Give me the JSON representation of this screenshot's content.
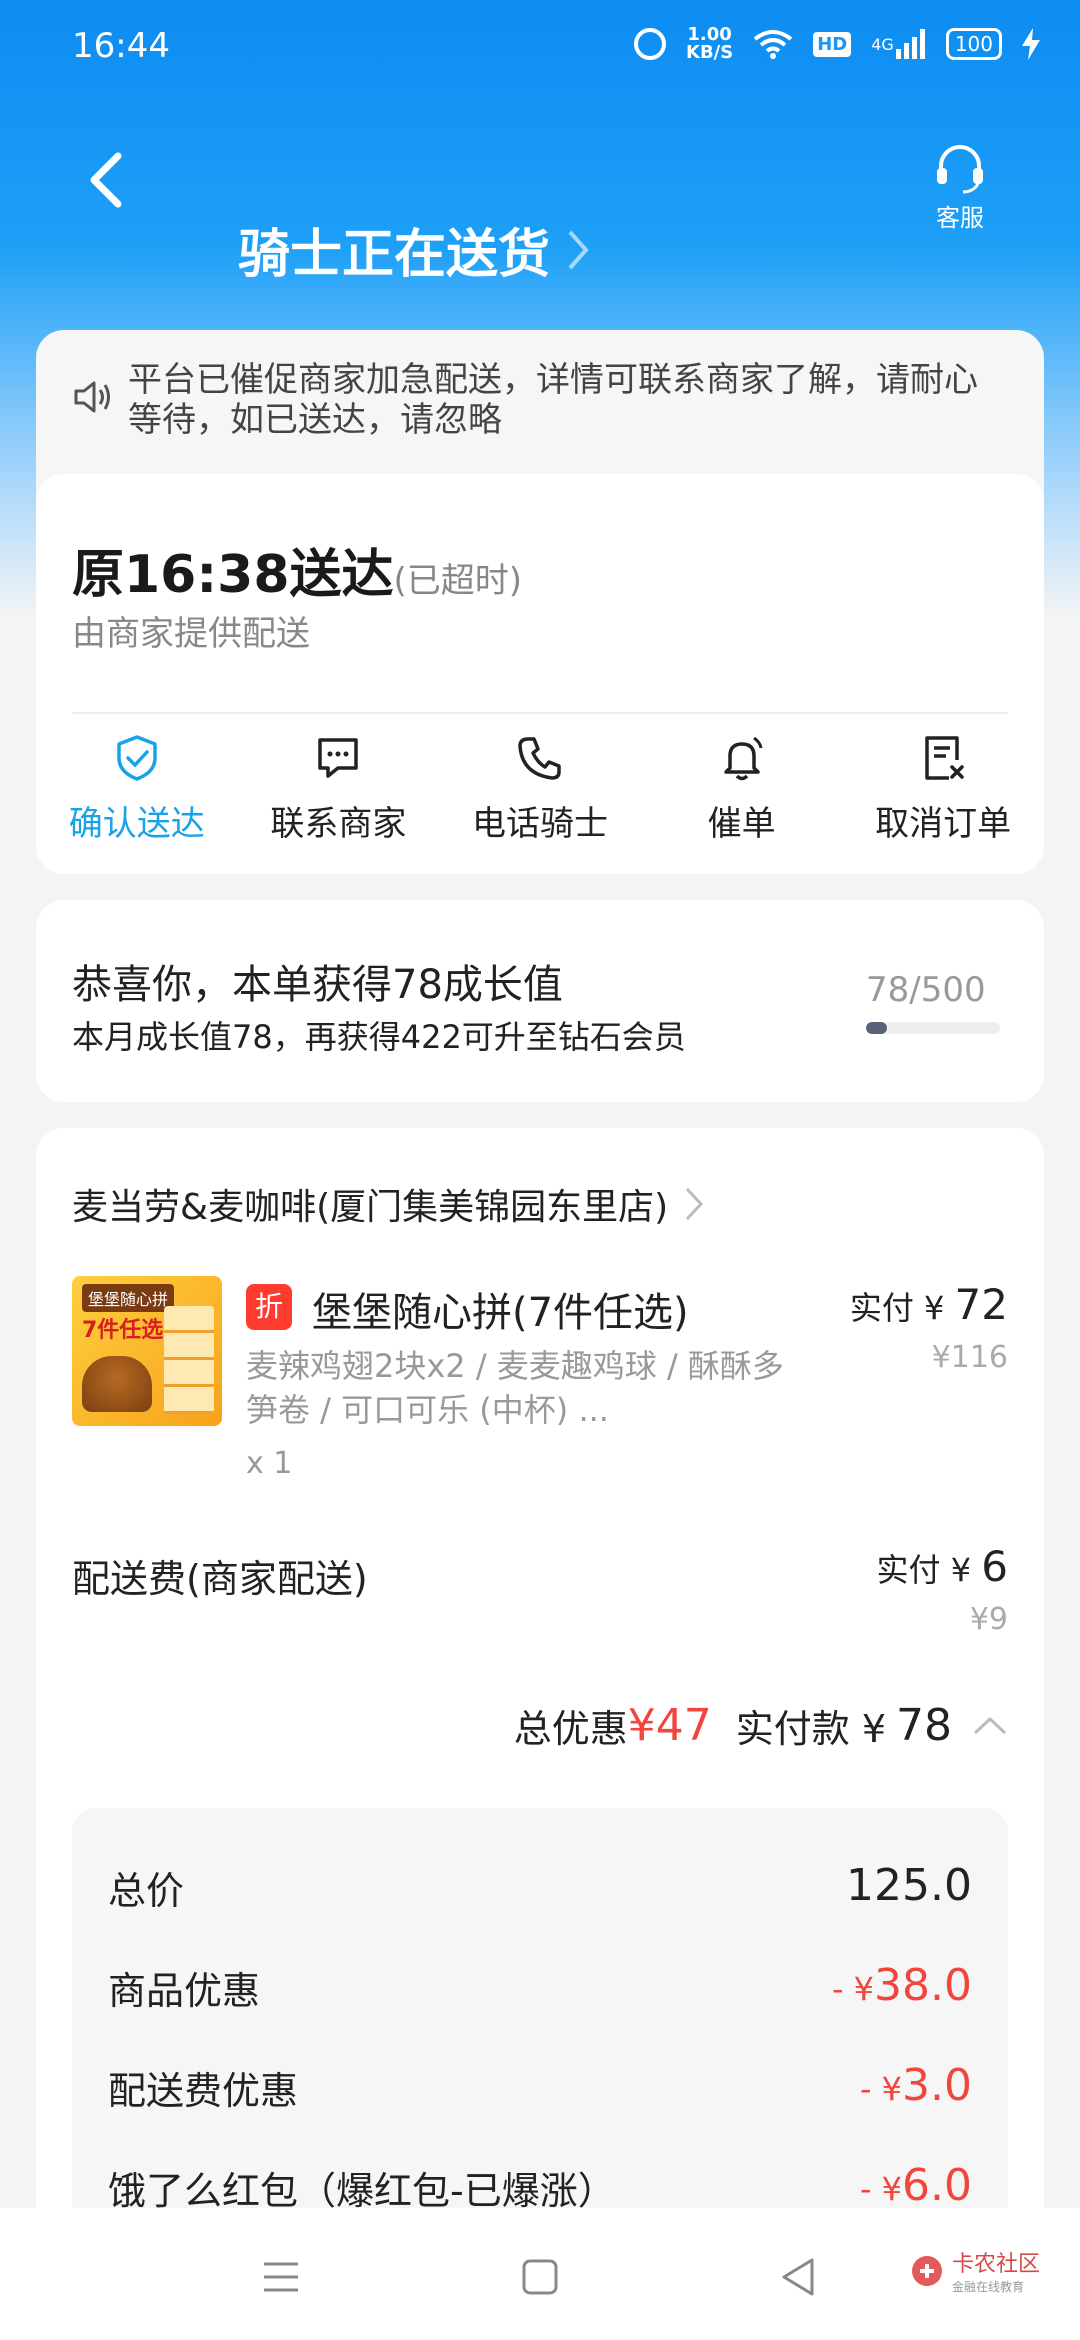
{
  "status_bar": {
    "time": "16:44",
    "net_speed_value": "1.00",
    "net_speed_unit": "KB/S",
    "hd": "HD",
    "signal": "4G",
    "battery": "100"
  },
  "header": {
    "title": "骑士正在送货",
    "service_label": "客服"
  },
  "notice": {
    "text": "平台已催促商家加急配送，详情可联系商家了解，请耐心等待，如已送达，请忽略"
  },
  "delivery": {
    "eta": "原16:38送达",
    "late_tag": "(已超时)",
    "provider": "由商家提供配送",
    "actions": [
      {
        "label": "确认送达",
        "icon": "confirm-check-icon"
      },
      {
        "label": "联系商家",
        "icon": "chat-icon"
      },
      {
        "label": "电话骑士",
        "icon": "phone-icon"
      },
      {
        "label": "催单",
        "icon": "bell-icon"
      },
      {
        "label": "取消订单",
        "icon": "cancel-order-icon"
      }
    ]
  },
  "growth": {
    "headline": "恭喜你，本单获得78成长值",
    "sub": "本月成长值78，再获得422可升至钻石会员",
    "progress_text": "78/500",
    "progress_fraction": 0.156
  },
  "order": {
    "store_name": "麦当劳&麦咖啡(厦门集美锦园东里店)",
    "product": {
      "image_tag": "堡堡随心拼",
      "image_title": "7件任选",
      "discount_badge": "折",
      "name": "堡堡随心拼(7件任选)",
      "desc": "麦辣鸡翅2块x2 / 麦麦趣鸡球 / 酥酥多笋卷 / 可口可乐 (中杯) ...",
      "qty": "x 1",
      "paid_label": "实付 ¥",
      "paid_value": "72",
      "original": "¥116"
    },
    "delivery_fee": {
      "label": "配送费(商家配送)",
      "paid_label": "实付 ¥",
      "paid_value": "6",
      "original": "¥9"
    },
    "summary": {
      "discount_label": "总优惠",
      "discount_value": "¥47",
      "paid_label": "实付款 ¥",
      "paid_value": "78"
    },
    "breakdown": [
      {
        "label": "总价",
        "value": "125.0",
        "red": false
      },
      {
        "label": "商品优惠",
        "value": "38.0",
        "red": true
      },
      {
        "label": "配送费优惠",
        "value": "3.0",
        "red": true
      },
      {
        "label": "饿了么红包（爆红包-已爆涨）",
        "value": "6.0",
        "red": true
      }
    ],
    "minus_prefix": "- ¥"
  },
  "watermark": {
    "title": "卡农社区",
    "subtitle": "金融在线教育"
  },
  "colors": {
    "brand_blue": "#0d8cf2",
    "active_blue": "#1aa2e8",
    "discount_red": "#f0463c"
  }
}
